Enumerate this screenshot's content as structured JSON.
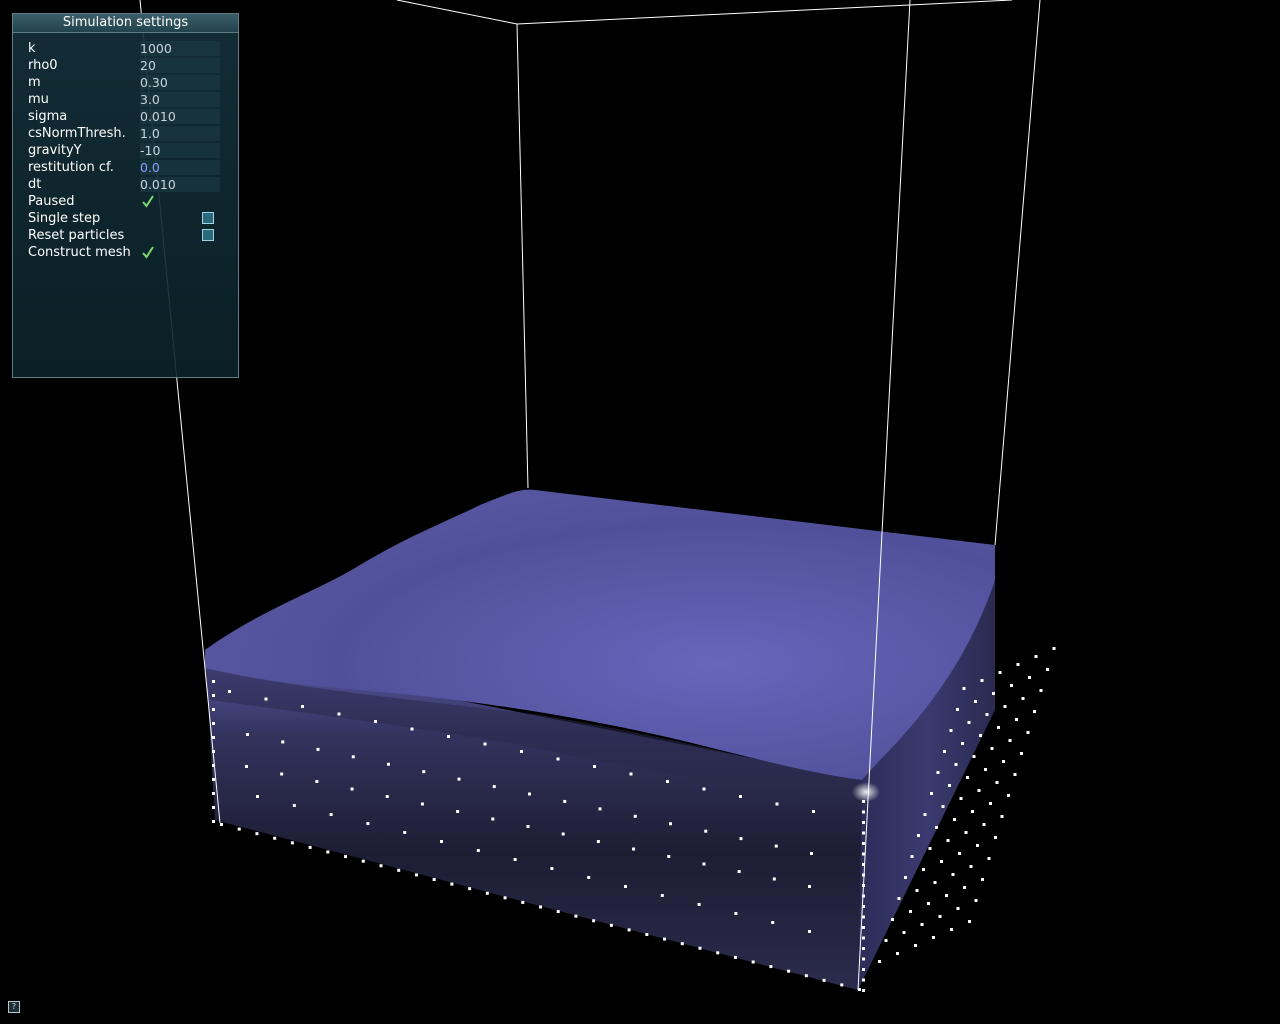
{
  "panel": {
    "title": "Simulation settings",
    "params": [
      {
        "label": "k",
        "value": "1000"
      },
      {
        "label": "rho0",
        "value": "20"
      },
      {
        "label": "m",
        "value": "0.30"
      },
      {
        "label": "mu",
        "value": "3.0"
      },
      {
        "label": "sigma",
        "value": "0.010"
      },
      {
        "label": "csNormThresh.",
        "value": "1.0"
      },
      {
        "label": "gravityY",
        "value": "-10"
      },
      {
        "label": "restitution cf.",
        "value": "0.0"
      },
      {
        "label": "dt",
        "value": "0.010"
      }
    ],
    "toggles": [
      {
        "label": "Paused",
        "checked": true
      },
      {
        "label": "Single step",
        "checked": false
      },
      {
        "label": "Reset particles",
        "checked": false
      },
      {
        "label": "Construct mesh",
        "checked": true
      }
    ]
  },
  "help_icon": "?",
  "colors": {
    "fluid_top": "#5858a8",
    "fluid_side": "#1e1e38",
    "box_lines": "#ffffff",
    "check": "#7cd870",
    "highlight_value": "#8a9cff"
  }
}
